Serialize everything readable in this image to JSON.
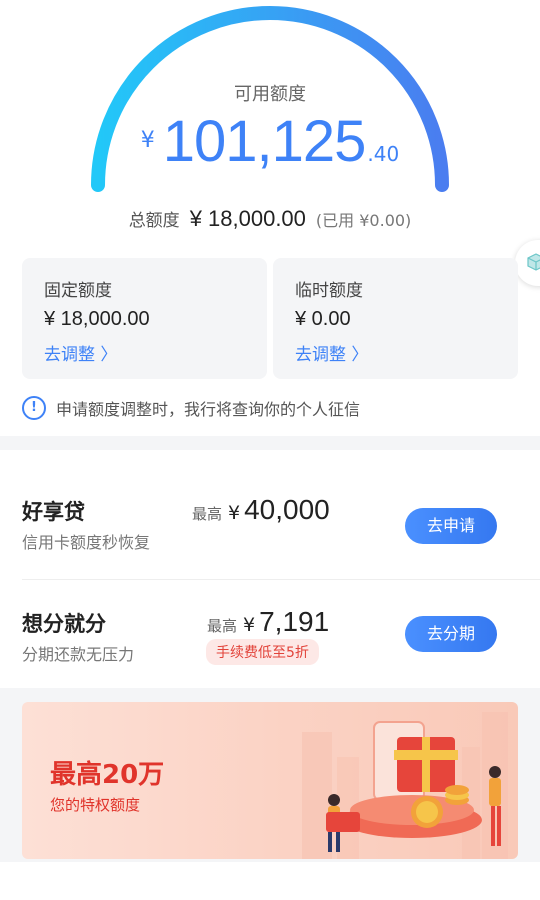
{
  "credit": {
    "available_label": "可用额度",
    "currency": "¥",
    "available_int": "101,125",
    "available_dec": ".40",
    "total_label": "总额度",
    "total_value": "¥ 18,000.00",
    "used_text": "(已用 ¥0.00)"
  },
  "cards": [
    {
      "title": "固定额度",
      "value": "¥ 18,000.00",
      "action": "去调整 〉"
    },
    {
      "title": "临时额度",
      "value": "¥ 0.00",
      "action": "去调整 〉"
    }
  ],
  "notice": {
    "icon": "!",
    "text": "申请额度调整时，我行将查询你的个人征信"
  },
  "products": [
    {
      "name": "好享贷",
      "desc": "信用卡额度秒恢复",
      "max_label": "最高",
      "currency": "¥",
      "max_value": "40,000",
      "button": "去申请"
    },
    {
      "name": "想分就分",
      "desc": "分期还款无压力",
      "max_label": "最高",
      "currency": "¥",
      "max_value": "7,191",
      "tag": "手续费低至5折",
      "button": "去分期"
    }
  ],
  "banner": {
    "title": "最高20万",
    "subtitle": "您的特权额度"
  },
  "colors": {
    "accent": "#3e82f7",
    "gauge_start": "#22c8f8",
    "gauge_end": "#4a7df0",
    "promo_red": "#e0342b"
  },
  "icons": {
    "info": "info-icon",
    "side_tab": "cube-icon"
  }
}
